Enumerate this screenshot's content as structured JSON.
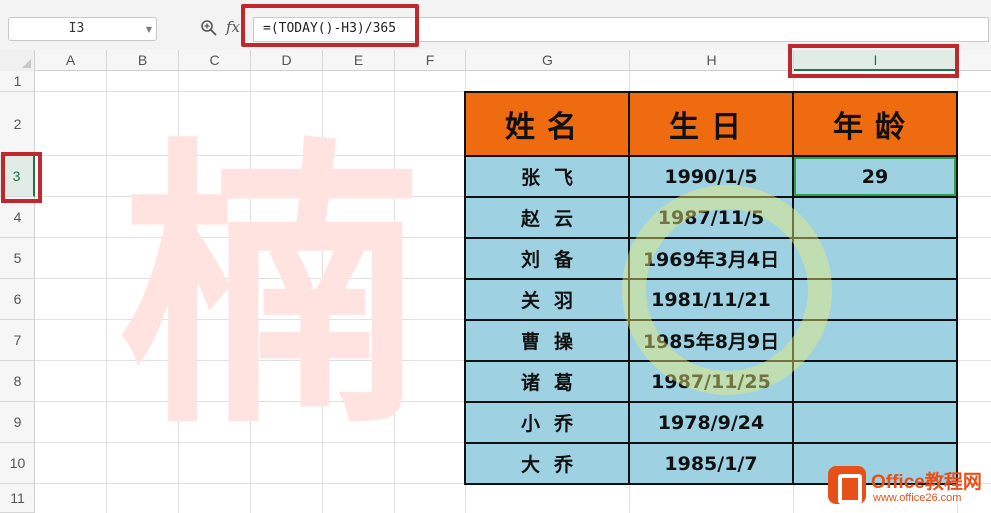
{
  "formula_bar": {
    "name_box": "I3",
    "fx_label": "fx",
    "formula": "=(TODAY()-H3)/365"
  },
  "columns": [
    "A",
    "B",
    "C",
    "D",
    "E",
    "F",
    "G",
    "H",
    "I"
  ],
  "rows": [
    "1",
    "2",
    "3",
    "4",
    "5",
    "6",
    "7",
    "8",
    "9",
    "10",
    "11"
  ],
  "selected_cell": "I3",
  "watermark_text": "楠",
  "table": {
    "headers": [
      "姓名",
      "生日",
      "年龄"
    ],
    "rows": [
      {
        "name": "张飞",
        "birthday": "1990/1/5",
        "age": "29"
      },
      {
        "name": "赵云",
        "birthday": "1987/11/5",
        "age": ""
      },
      {
        "name": "刘备",
        "birthday": "1969年3月4日",
        "age": ""
      },
      {
        "name": "关羽",
        "birthday": "1981/11/21",
        "age": ""
      },
      {
        "name": "曹操",
        "birthday": "1985年8月9日",
        "age": ""
      },
      {
        "name": "诸葛",
        "birthday": "1987/11/25",
        "age": ""
      },
      {
        "name": "小乔",
        "birthday": "1978/9/24",
        "age": ""
      },
      {
        "name": "大乔",
        "birthday": "1985/1/7",
        "age": ""
      }
    ]
  },
  "logo": {
    "name": "Office教程网",
    "url": "www.office26.com"
  },
  "colors": {
    "header_fill": "#ee6b10",
    "body_fill": "#9ed1e2",
    "highlight_box": "#c0282d",
    "selection": "#217346"
  }
}
